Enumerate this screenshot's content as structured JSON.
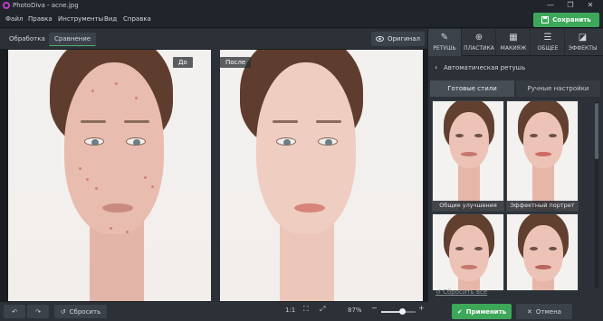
{
  "window": {
    "title": "PhotoDiva - acne.jpg",
    "controls": [
      "—",
      "❐",
      "✕"
    ]
  },
  "menu": {
    "items": [
      "Файл",
      "Правка",
      "Инструменты",
      "Вид",
      "Справка"
    ]
  },
  "header": {
    "save_label": "Сохранить",
    "save_color": "#3da85a"
  },
  "toolbar": {
    "tabs": [
      {
        "label": "Обработка",
        "active": false
      },
      {
        "label": "Сравнение",
        "active": true
      }
    ],
    "original_label": "Оригинал"
  },
  "canvas": {
    "before_label": "До",
    "after_label": "После"
  },
  "right_panel": {
    "tabs": [
      {
        "label": "РЕТУШЬ",
        "icon": "brush-icon",
        "active": true
      },
      {
        "label": "ПЛАСТИКА",
        "icon": "liquify-icon",
        "active": false
      },
      {
        "label": "МАКИЯЖ",
        "icon": "makeup-icon",
        "active": false
      },
      {
        "label": "ОБЩЕЕ",
        "icon": "sliders-icon",
        "active": false
      },
      {
        "label": "ЭФФЕКТЫ",
        "icon": "effects-icon",
        "active": false
      }
    ],
    "section_title": "Автоматическая ретушь",
    "subtabs": [
      {
        "label": "Готовые стили",
        "active": true
      },
      {
        "label": "Ручные настройки",
        "active": false
      }
    ],
    "styles": [
      {
        "caption": "Общие улучшения"
      },
      {
        "caption": "Эффектный портрет"
      },
      {
        "caption": ""
      },
      {
        "caption": ""
      }
    ],
    "reset_all_label": "Сбросить все"
  },
  "bottom_bar": {
    "reset_label": "Сбросить",
    "zoom_ratio_label": "1:1",
    "zoom_percent": "87%",
    "zoom_value": 0.62,
    "apply_label": "Применить",
    "cancel_label": "Отмена"
  }
}
